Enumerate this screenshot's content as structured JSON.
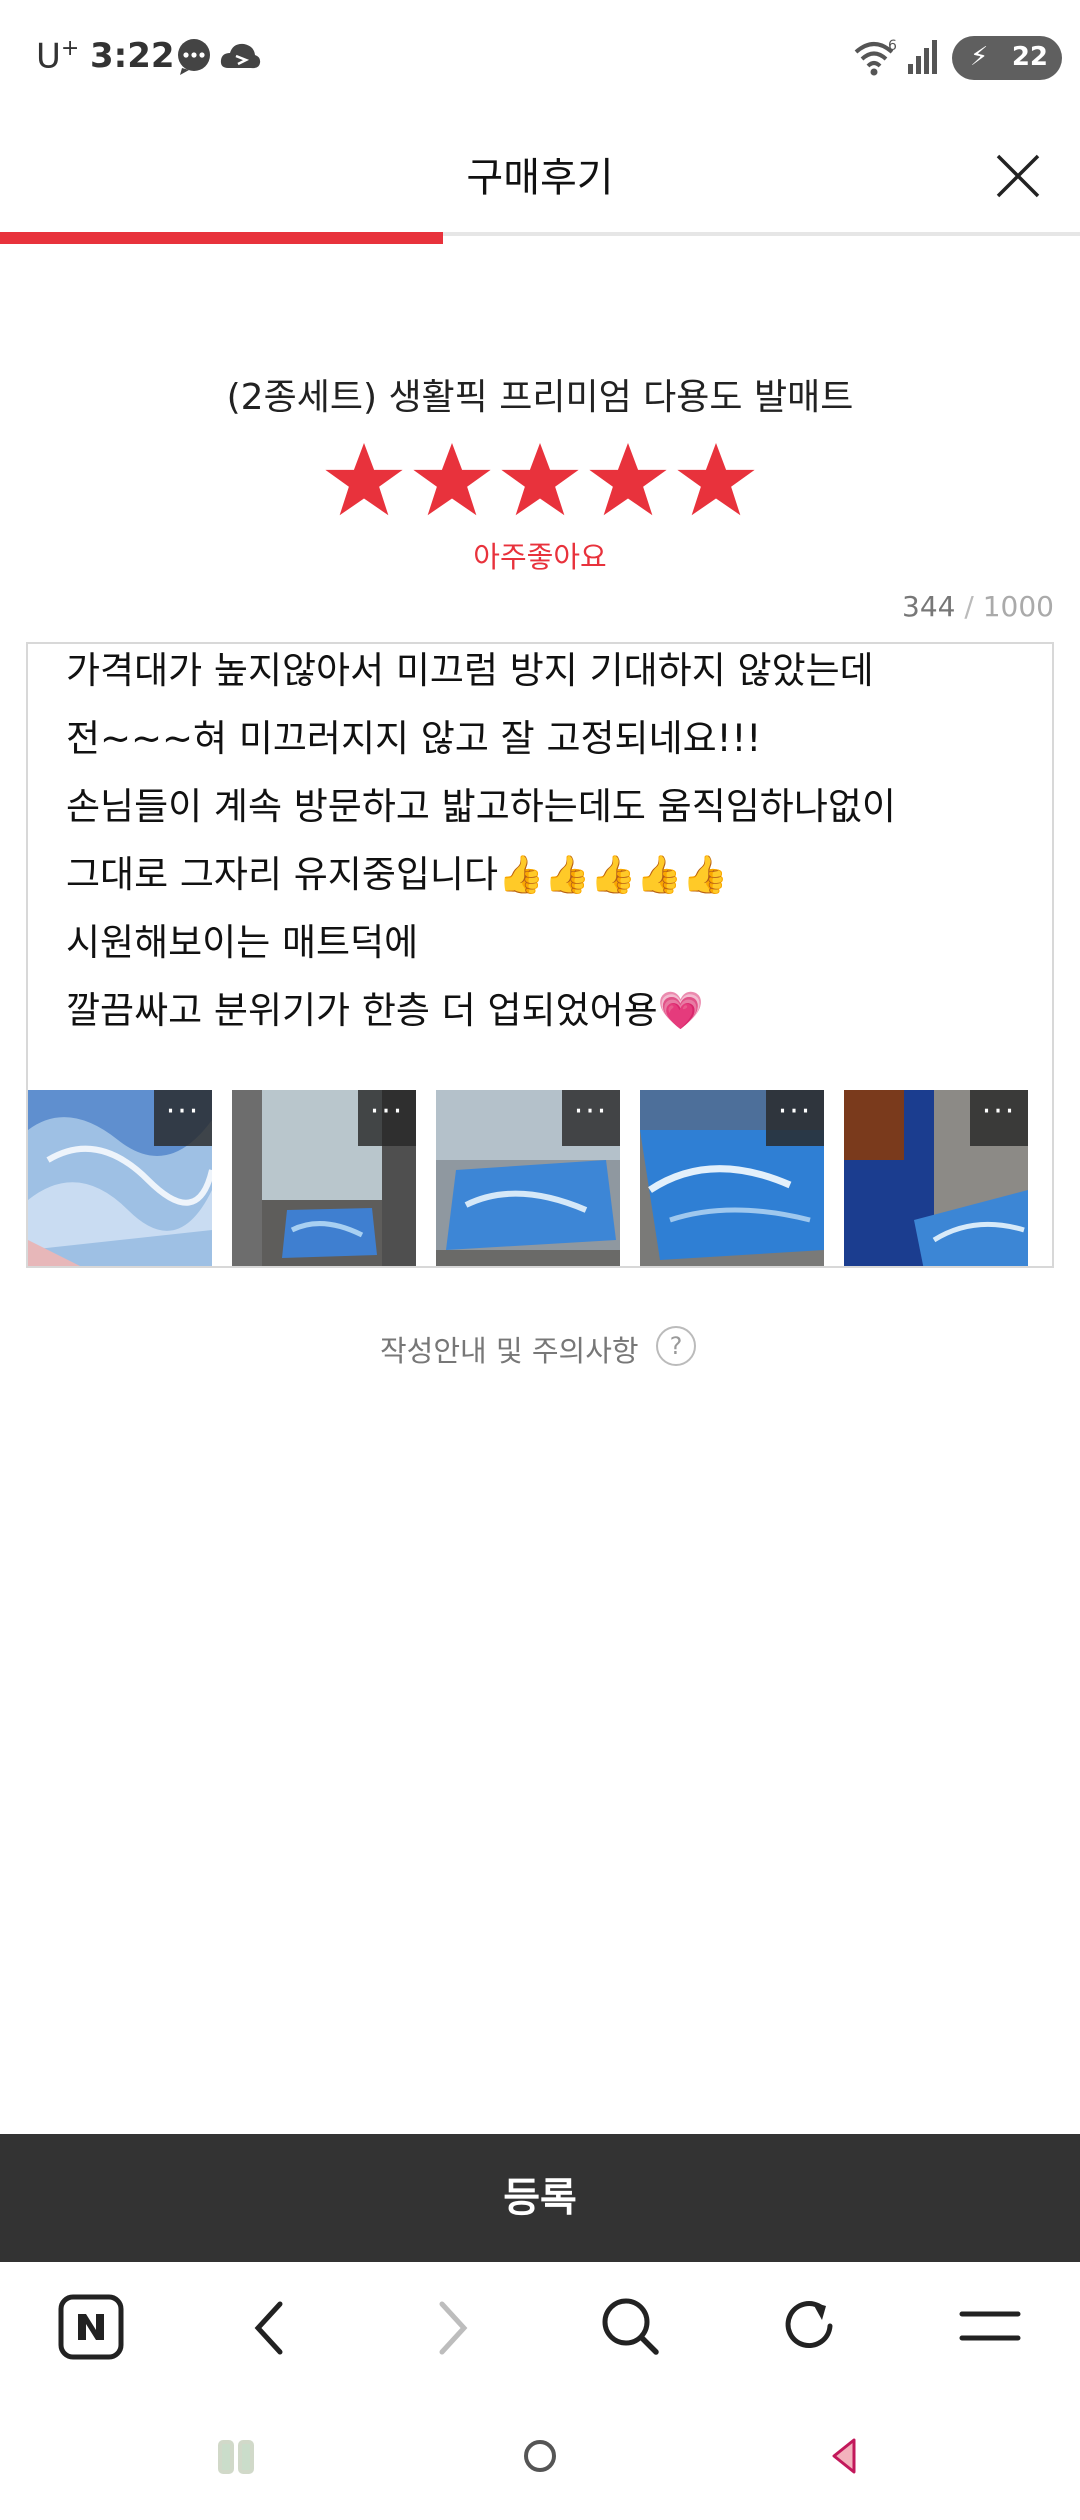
{
  "status_bar": {
    "carrier": "U",
    "carrier_sup": "+",
    "time": "3:22",
    "wifi_badge": "6",
    "battery": "22",
    "icons": [
      "chat-bubble-icon",
      "cloud-icon",
      "wifi-icon",
      "signal-icon",
      "battery-icon"
    ]
  },
  "header": {
    "title": "구매후기",
    "close_icon": "close-icon"
  },
  "progress": {
    "value_fraction": 0.41,
    "color": "#e8323c"
  },
  "product": {
    "name": "(2종세트) 생활픽 프리미엄 다용도 발매트",
    "rating_stars": 5,
    "rating_max": 5,
    "rating_label": "아주좋아요",
    "star_color": "#e8323c"
  },
  "review": {
    "char_count": "344",
    "char_sep": " / ",
    "char_max": "1000",
    "lines": [
      "가격대가 높지않아서 미끄럼 방지 기대하지 않았는데",
      "전~~~혀 미끄러지지 않고 잘 고정되네요!!!",
      "손님들이 계속 방문하고 밟고하는데도 움직임하나없이",
      "그대로 그자리 유지중입니다👍👍👍👍👍",
      "시원해보이는 매트덕에",
      "깔끔싸고 분위기가 한층 더 업되었어용💗"
    ],
    "photos": [
      {
        "more_label": "···"
      },
      {
        "more_label": "···"
      },
      {
        "more_label": "···"
      },
      {
        "more_label": "···"
      },
      {
        "more_label": "···"
      }
    ]
  },
  "guide": {
    "text": "작성안내 및 주의사항",
    "help_label": "?"
  },
  "submit": {
    "label": "등록"
  },
  "browser_toolbar": {
    "items": [
      "naver-home-icon",
      "back-arrow-icon",
      "forward-arrow-icon",
      "search-icon",
      "refresh-icon",
      "menu-icon"
    ]
  },
  "system_nav": {
    "items": [
      "recent-apps-icon",
      "home-icon",
      "back-icon"
    ]
  }
}
